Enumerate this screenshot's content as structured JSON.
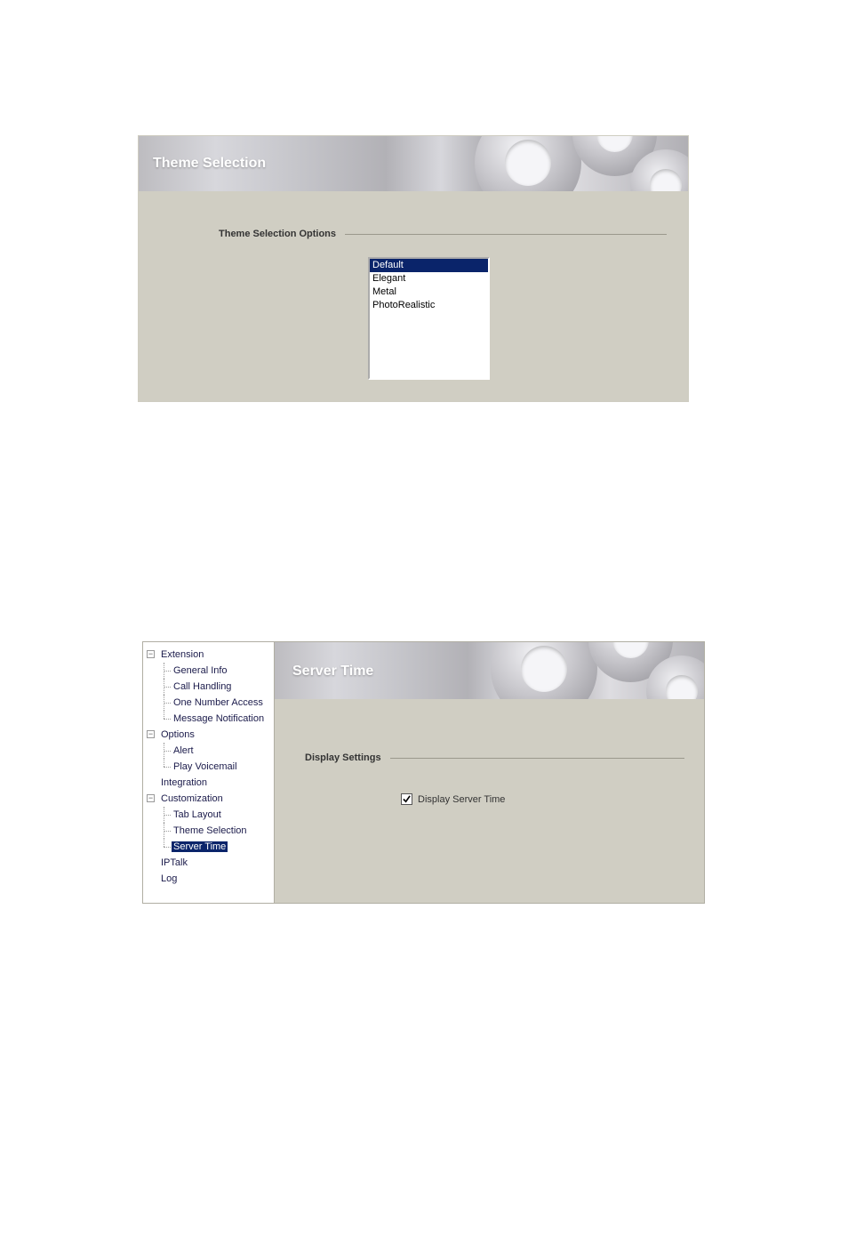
{
  "panel1": {
    "banner_title": "Theme Selection",
    "section_label": "Theme Selection Options",
    "themes": [
      "Default",
      "Elegant",
      "Metal",
      "PhotoRealistic"
    ],
    "selected_index": 0
  },
  "panel2": {
    "banner_title": "Server Time",
    "section_label": "Display Settings",
    "checkbox_label": "Display Server Time",
    "checkbox_checked": true,
    "tree": {
      "extension": {
        "label": "Extension",
        "children": {
          "general_info": "General Info",
          "call_handling": "Call Handling",
          "one_number_access": "One Number Access",
          "message_notification": "Message Notification"
        }
      },
      "options": {
        "label": "Options",
        "children": {
          "alert": "Alert",
          "play_voicemail": "Play Voicemail"
        }
      },
      "integration": {
        "label": "Integration"
      },
      "customization": {
        "label": "Customization",
        "children": {
          "tab_layout": "Tab Layout",
          "theme_selection": "Theme Selection",
          "server_time": "Server Time"
        }
      },
      "iptalk": {
        "label": "IPTalk"
      },
      "log": {
        "label": "Log"
      },
      "selected": "server_time"
    }
  }
}
